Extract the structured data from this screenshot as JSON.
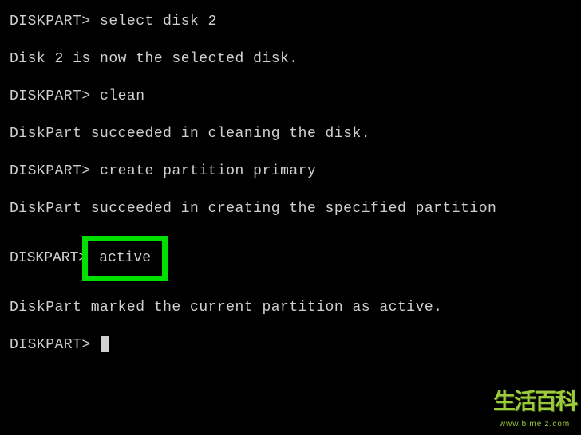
{
  "terminal": {
    "prompt": "DISKPART>",
    "lines": {
      "l1_cmd": "select disk 2",
      "l2_out": "Disk 2 is now the selected disk.",
      "l3_cmd": "clean",
      "l4_out": "DiskPart succeeded in cleaning the disk.",
      "l5_cmd": "create partition primary",
      "l6_out": "DiskPart succeeded in creating the specified partition",
      "l7_cmd": "active",
      "l8_out": "DiskPart marked the current partition as active."
    }
  },
  "highlight": {
    "text": "active",
    "color": "#00e000"
  },
  "watermark": {
    "chars": "生活百科",
    "url": "www.bimeiz.com"
  }
}
